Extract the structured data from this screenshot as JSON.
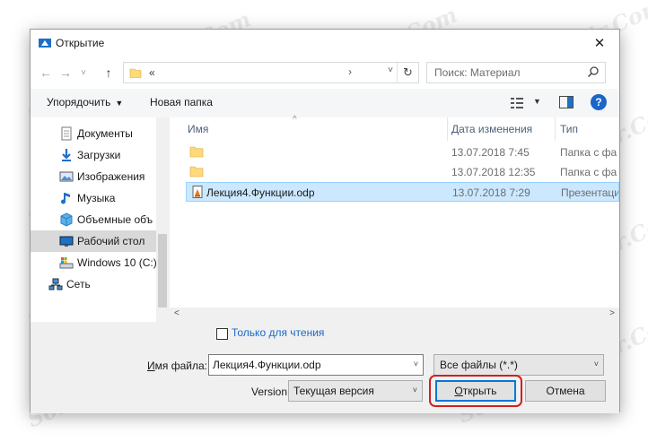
{
  "window": {
    "title": "Открытие",
    "close_glyph": "✕"
  },
  "address": {
    "back_glyph": "←",
    "forward_glyph": "→",
    "up_glyph": "↑",
    "recent_glyph": "˅",
    "breadcrumb": "«",
    "crumb_arrow": "›",
    "dropdown_glyph": "˅",
    "refresh_glyph": "↻"
  },
  "search": {
    "placeholder": "Поиск: Материал"
  },
  "toolbar": {
    "organize_label": "Упорядочить",
    "organize_caret": "▼",
    "new_folder_label": "Новая папка",
    "view_caret": "▼",
    "help_glyph": "?"
  },
  "nav": {
    "items": [
      {
        "label": "Документы",
        "icon": "documents-icon"
      },
      {
        "label": "Загрузки",
        "icon": "downloads-icon"
      },
      {
        "label": "Изображения",
        "icon": "pictures-icon"
      },
      {
        "label": "Музыка",
        "icon": "music-icon"
      },
      {
        "label": "Объемные объ",
        "icon": "3d-objects-icon"
      },
      {
        "label": "Рабочий стол",
        "icon": "desktop-icon",
        "selected": true
      },
      {
        "label": "Windows 10 (C:)",
        "icon": "drive-icon"
      },
      {
        "label": "Сеть",
        "icon": "network-icon"
      }
    ]
  },
  "files": {
    "columns": {
      "name": "Имя",
      "date": "Дата изменения",
      "type": "Тип"
    },
    "sort_glyph": "^",
    "rows": [
      {
        "name": "",
        "date": "13.07.2018 7:45",
        "type": "Папка с файлами",
        "icon": "folder-icon"
      },
      {
        "name": "",
        "date": "13.07.2018 12:35",
        "type": "Папка с файлами",
        "icon": "folder-icon"
      },
      {
        "name": "Лекция4.Функции.odp",
        "date": "13.07.2018 7:29",
        "type": "Презентация Ope",
        "icon": "presentation-icon",
        "selected": true
      }
    ],
    "scroll_left_glyph": "<",
    "scroll_right_glyph": ">"
  },
  "bottom": {
    "readonly_label": "Только для чтения",
    "filename_label": "Имя файла:",
    "filename_value": "Лекция4.Функции.odp",
    "filetype_value": "Все файлы (*.*)",
    "version_label": "Version",
    "version_value": "Текущая версия",
    "open_label": "Открыть",
    "cancel_label": "Отмена",
    "dropdown_glyph": "˅"
  },
  "watermark": "Soringpcrepair.Com",
  "colors": {
    "accent": "#0078d7",
    "highlight_ring": "#d02020",
    "selection": "#cce8ff",
    "link": "#1a68c9"
  }
}
